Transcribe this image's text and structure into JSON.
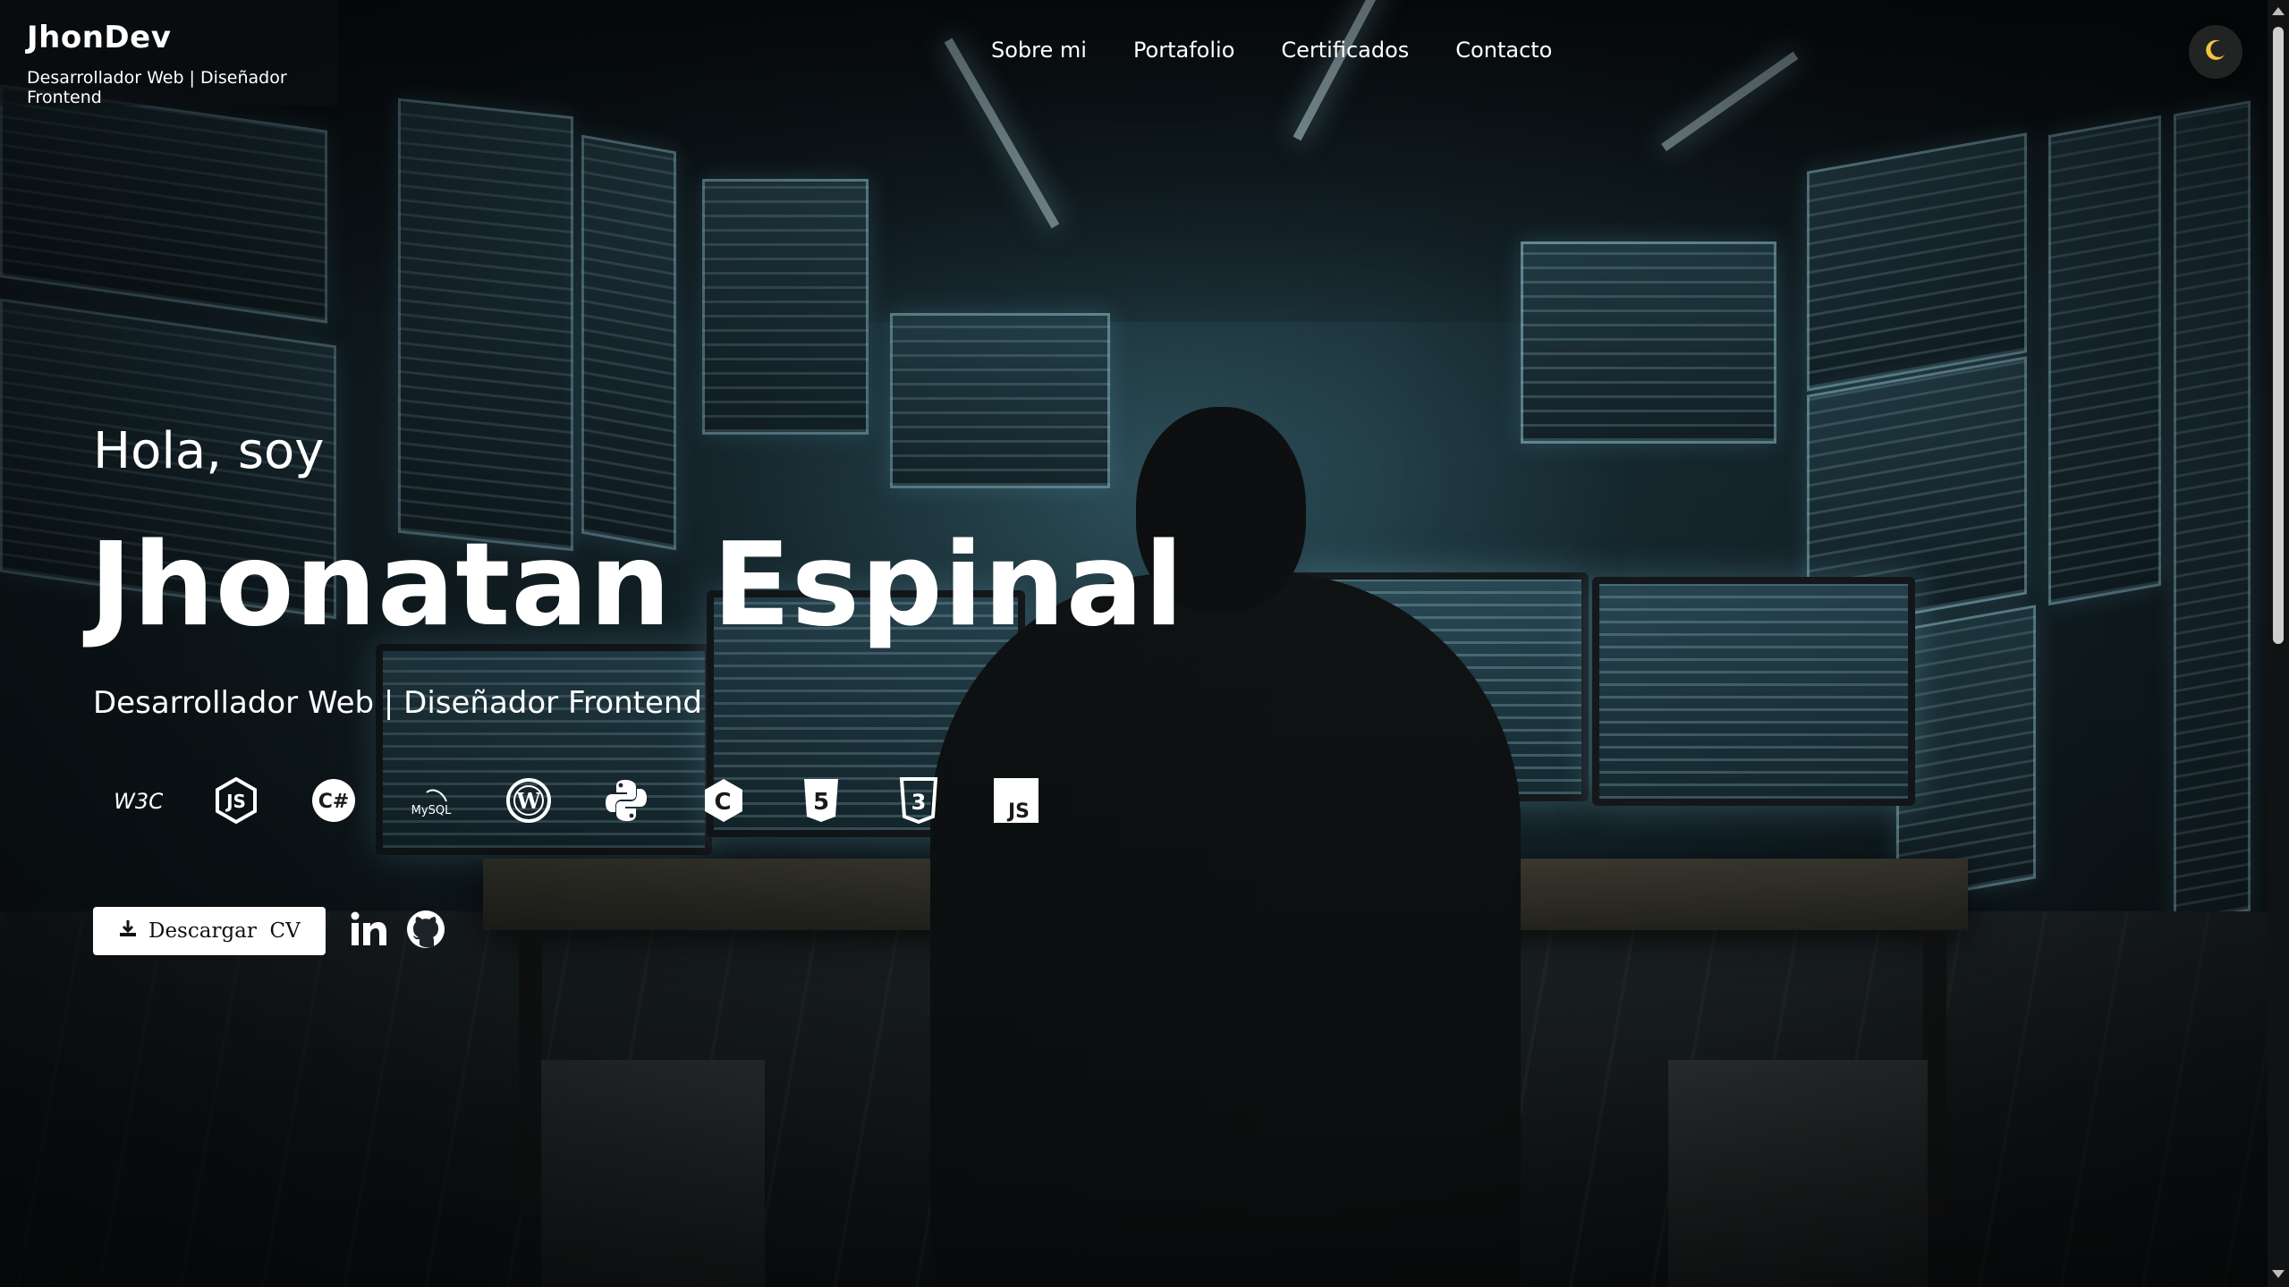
{
  "header": {
    "brand_title": "JhonDev",
    "brand_subtitle": "Desarrollador Web | Diseñador Frontend",
    "nav": [
      {
        "label": "Sobre mi"
      },
      {
        "label": "Portafolio"
      },
      {
        "label": "Certificados"
      },
      {
        "label": "Contacto"
      }
    ],
    "theme_toggle_icon": "moon-icon"
  },
  "hero": {
    "greeting": "Hola, soy",
    "name": "Jhonatan Espinal",
    "role": "Desarrollador Web | Diseñador Frontend",
    "skills": [
      {
        "icon": "w3c-icon",
        "text": "W3C"
      },
      {
        "icon": "nodejs-icon",
        "text": "JS"
      },
      {
        "icon": "csharp-icon",
        "text": "C#"
      },
      {
        "icon": "mysql-icon",
        "text": "MySQL"
      },
      {
        "icon": "wordpress-icon",
        "text": ""
      },
      {
        "icon": "python-icon",
        "text": ""
      },
      {
        "icon": "c-language-icon",
        "text": "C"
      },
      {
        "icon": "html5-icon",
        "text": "5"
      },
      {
        "icon": "css3-icon",
        "text": "3"
      },
      {
        "icon": "javascript-icon",
        "text": "JS"
      }
    ],
    "download_cv_label": "Descargar  CV",
    "download_icon": "download-icon",
    "social": [
      {
        "icon": "linkedin-icon"
      },
      {
        "icon": "github-icon"
      }
    ]
  },
  "colors": {
    "text": "#ffffff",
    "button_bg": "#ffffff",
    "button_text": "#111111",
    "toggle_bg": "#282828",
    "moon": "#f5c542"
  }
}
